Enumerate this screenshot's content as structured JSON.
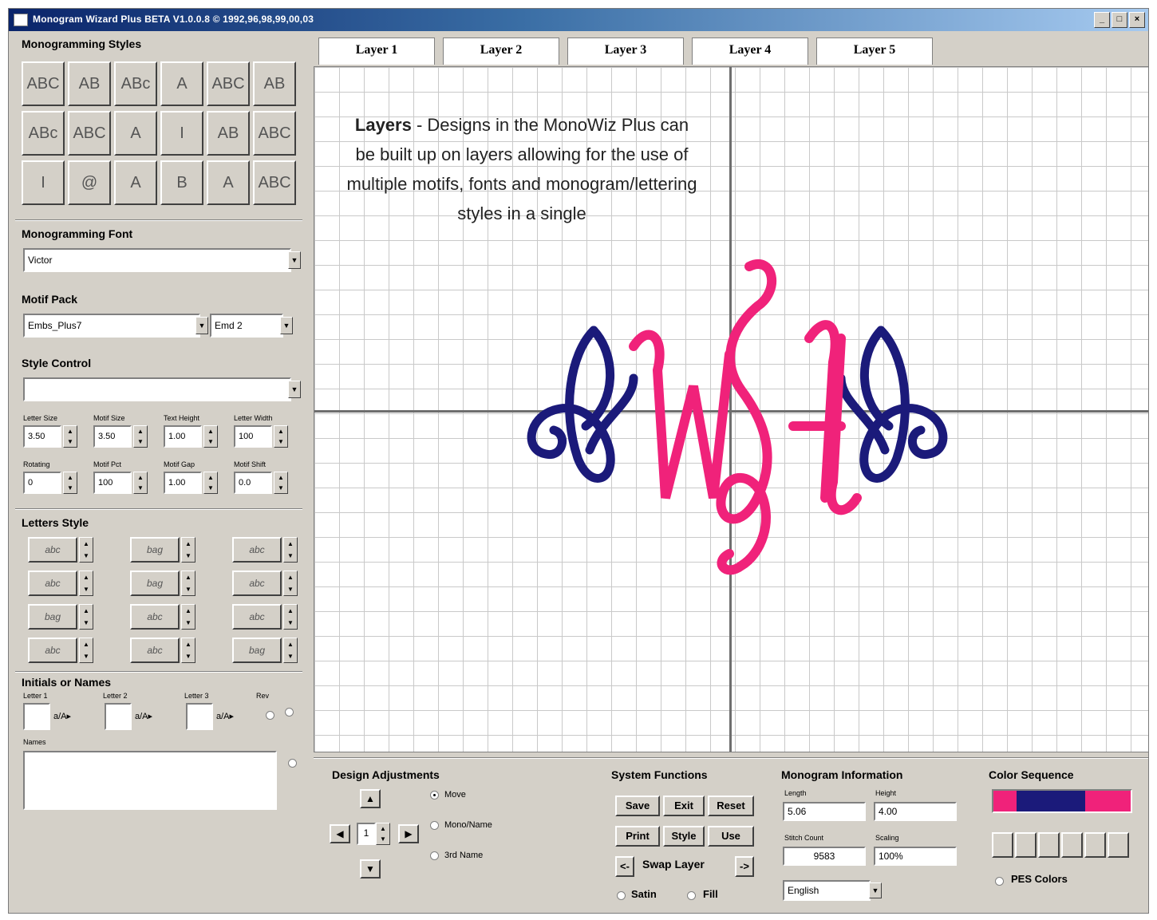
{
  "window": {
    "title": "Monogram Wizard Plus BETA V1.0.0.8 © 1992,96,98,99,00,03",
    "min": "_",
    "max": "□",
    "close": "×"
  },
  "left": {
    "styles_label": "Monogramming Styles",
    "style_icons": [
      "ABC",
      "AB",
      "ABc",
      "A",
      "ABC",
      "AB",
      "ABc",
      "ABC",
      "A",
      "I",
      "AB",
      "ABC",
      "I",
      "@",
      "A",
      "B",
      "A",
      "ABC"
    ],
    "font_label": "Monogramming Font",
    "font_value": "Victor",
    "motif_label": "Motif Pack",
    "motif_value": "Embs_Plus7",
    "motif_number": "Emd 2",
    "style_control_label": "Style Control",
    "style_control_value": "",
    "params": [
      {
        "label": "Letter Size",
        "value": "3.50"
      },
      {
        "label": "Motif Size",
        "value": "3.50"
      },
      {
        "label": "Text Height",
        "value": "1.00"
      },
      {
        "label": "Letter Width",
        "value": "100"
      },
      {
        "label": "Rotating",
        "value": "0"
      },
      {
        "label": "Motif Pct",
        "value": "100"
      },
      {
        "label": "Motif Gap",
        "value": "1.00"
      },
      {
        "label": "Motif Shift",
        "value": "0.0"
      }
    ],
    "letters_label": "Letters Style",
    "letter_styles": [
      "abc",
      "bag",
      "abc",
      "abc",
      "bag",
      "abc",
      "bag",
      "abc",
      "abc",
      "abc",
      "abc",
      "bag"
    ],
    "initials_label": "Initials or Names",
    "initial_labels": [
      "Letter 1",
      "Letter 2",
      "Letter 3",
      "Rev"
    ],
    "initials": [
      "",
      "",
      ""
    ],
    "names_label": "Names"
  },
  "tabs": [
    "Layer 1",
    "Layer 2",
    "Layer 3",
    "Layer 4",
    "Layer 5"
  ],
  "canvas": {
    "note_title": "Layers",
    "note_body": " - Designs in the MonoWiz Plus can be built up on layers allowing for the use of multiple motifs, fonts and monogram/lettering styles in a single",
    "monogram_letters": "WSH",
    "colors": {
      "pink": "#f0227a",
      "navy": "#1b1a7a",
      "grid": "#c9c9c9"
    }
  },
  "design_adjust": {
    "label": "Design Adjustments",
    "step": "1",
    "options": [
      "Move",
      "Mono/Name",
      "3rd Name"
    ]
  },
  "system": {
    "label": "System Functions",
    "buttons": [
      "Save",
      "Exit",
      "Reset",
      "Print",
      "Style",
      "Use"
    ],
    "swap_label": "Swap Layer",
    "fill_options": [
      "Satin",
      "Fill"
    ]
  },
  "info": {
    "label": "Monogram Information",
    "length_label": "Length",
    "length_value": "5.06",
    "height_label": "Height",
    "height_value": "4.00",
    "stitch_label": "Stitch Count",
    "stitch_value": "9583",
    "scale_label": "Scaling",
    "scale_value": "100%",
    "language": "English"
  },
  "colors": {
    "label": "Color Sequence",
    "sequence": [
      "#f0227a",
      "#1b1a7a",
      "#1b1a7a",
      "#1b1a7a",
      "#f0227a",
      "#f0227a"
    ],
    "pes_label": "PES Colors"
  }
}
